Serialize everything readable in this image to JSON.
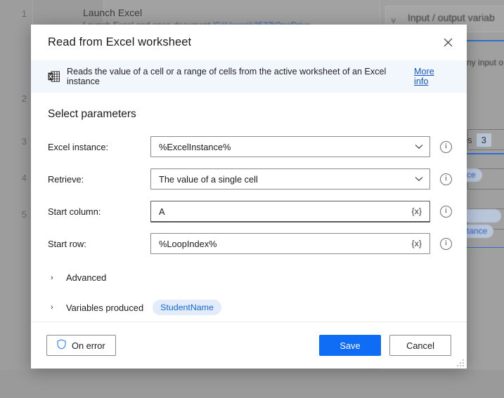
{
  "background": {
    "row_numbers": [
      "1",
      "2",
      "3",
      "4",
      "5"
    ],
    "action": {
      "title": "Launch Excel",
      "subtitle_prefix": "Launch Excel and open document ",
      "subtitle_path": "'C:\\Users\\k2527\\OneDrive"
    },
    "right_panel": {
      "chevron_icon": "chevron-down-icon",
      "title": "Input / output variab",
      "subtext": "ny input o",
      "variables_label": "les",
      "variables_count": "3",
      "pills": [
        "ce",
        "",
        "tance"
      ]
    }
  },
  "dialog": {
    "title": "Read from Excel worksheet",
    "close_icon": "close-icon",
    "info": {
      "icon": "excel-worksheet-icon",
      "text": "Reads the value of a cell or a range of cells from the active worksheet of an Excel instance",
      "link_label": "More info"
    },
    "section_title": "Select parameters",
    "fields": [
      {
        "label": "Excel instance:",
        "value": "%ExcelInstance%",
        "control": "dropdown",
        "trailing_icon": "chevron-down-icon",
        "info_icon": "info-icon"
      },
      {
        "label": "Retrieve:",
        "value": "The value of a single cell",
        "control": "dropdown",
        "trailing_icon": "chevron-down-icon",
        "info_icon": "info-icon"
      },
      {
        "label": "Start column:",
        "value": "A",
        "control": "text",
        "trailing_icon": "{x}",
        "info_icon": "info-icon",
        "focused": true
      },
      {
        "label": "Start row:",
        "value": "%LoopIndex%",
        "control": "text",
        "trailing_icon": "{x}",
        "info_icon": "info-icon",
        "focused": false
      }
    ],
    "advanced": {
      "caret_icon": "chevron-right-icon",
      "label": "Advanced"
    },
    "variables_produced": {
      "caret_icon": "chevron-right-icon",
      "label": "Variables produced",
      "pill": "StudentName"
    },
    "footer": {
      "on_error_label": "On error",
      "on_error_icon": "shield-icon",
      "save_label": "Save",
      "cancel_label": "Cancel",
      "resize_icon": "resize-grip-icon"
    }
  },
  "colors": {
    "primary": "#0f6cf5",
    "link": "#1155cc",
    "info_bar_bg": "#f2f6fd",
    "pill_bg": "#e2ecfb",
    "pill_text": "#1767dd",
    "shield": "#2b7cf3"
  }
}
